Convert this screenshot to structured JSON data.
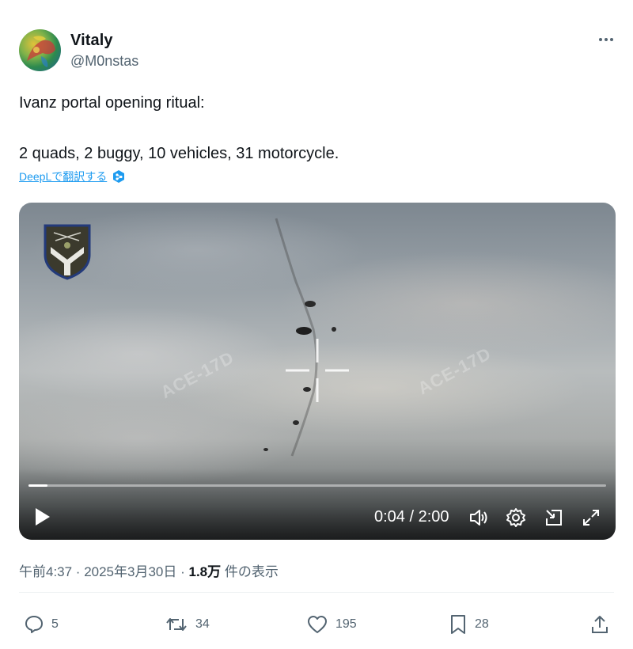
{
  "author": {
    "display_name": "Vitaly",
    "handle": "@M0nstas",
    "avatar_icon": "avatar-image"
  },
  "tweet": {
    "text_line1": "Ivanz portal opening ritual:",
    "text_line2": "2 quads, 2 buggy, 10 vehicles, 31 motorcycle.",
    "translate_label": "DeepLで翻訳する"
  },
  "video": {
    "time": "0:04 / 2:00",
    "progress_fraction": 0.033,
    "watermark": "ACE-17D"
  },
  "meta": {
    "timestamp": "午前4:37 · 2025年3月30日 · ",
    "views_count": "1.8万",
    "views_label": " 件の表示"
  },
  "actions": {
    "replies": "5",
    "reposts": "34",
    "likes": "195",
    "bookmarks": "28"
  },
  "colors": {
    "text": "#0f1419",
    "secondary": "#536471",
    "link": "#1d9bf0"
  }
}
